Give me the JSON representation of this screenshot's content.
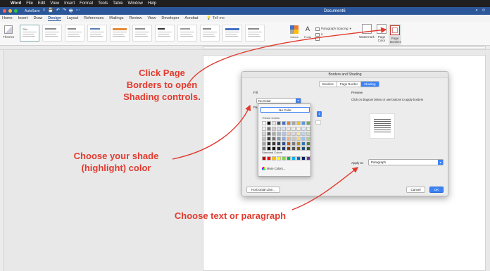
{
  "menubar": {
    "app": "Word",
    "items": [
      "File",
      "Edit",
      "View",
      "Insert",
      "Format",
      "Tools",
      "Table",
      "Window",
      "Help"
    ]
  },
  "titlebar": {
    "autosave": "AutoSave",
    "document_title": "Document6",
    "qat": [
      "⌂",
      "💾",
      "↶",
      "↷",
      "🖶",
      "⋯"
    ]
  },
  "tabs": [
    "Home",
    "Insert",
    "Draw",
    "Design",
    "Layout",
    "References",
    "Mailings",
    "Review",
    "View",
    "Developer",
    "Acrobat"
  ],
  "active_tab": "Design",
  "tell_me": "Tell me",
  "ribbon": {
    "themes_label": "Themes",
    "style_thumbs": [
      "Title",
      "",
      "",
      "",
      "",
      "",
      "",
      "",
      "",
      "",
      ""
    ],
    "colors_label": "Colors",
    "fonts_label": "Fonts",
    "paragraph_spacing_label": "Paragraph Spacing",
    "watermark_label": "Watermark",
    "page_color_label": "Page Color",
    "page_borders_label": "Page Borders"
  },
  "dialog": {
    "title": "Borders and Shading",
    "tabs": [
      "Borders",
      "Page Border",
      "Shading"
    ],
    "active_tab": "Shading",
    "fill_label": "Fill",
    "fill_value": "No Color",
    "pattern_label": "Pa",
    "preview_label": "Preview",
    "preview_hint": "Click on diagram below or use buttons to apply borders",
    "apply_to_label": "Apply to:",
    "apply_to_value": "Paragraph",
    "horizontal_line_label": "Horizontal Line...",
    "cancel_label": "Cancel",
    "ok_label": "OK"
  },
  "palette": {
    "no_color_label": "No Color",
    "theme_colors_label": "Theme Colors",
    "standard_colors_label": "Standard Colors",
    "more_colors_label": "More Colors...",
    "theme_top": [
      "#ffffff",
      "#000000",
      "#e7e6e6",
      "#44546a",
      "#4472c4",
      "#ed7d31",
      "#a5a5a5",
      "#ffc000",
      "#5b9bd5",
      "#70ad47"
    ],
    "theme_shades": [
      [
        "#f2f2f2",
        "#7f7f7f",
        "#d0cece",
        "#d6dce4",
        "#d9e2f3",
        "#fbe5d6",
        "#ededed",
        "#fff2cc",
        "#deebf6",
        "#e2efd9"
      ],
      [
        "#d9d9d9",
        "#595959",
        "#aeabab",
        "#adb9ca",
        "#b4c6e7",
        "#f7cbac",
        "#dbdbdb",
        "#fee599",
        "#bdd7ee",
        "#c5e0b3"
      ],
      [
        "#bfbfbf",
        "#3f3f3f",
        "#757070",
        "#8496b0",
        "#8eaadb",
        "#f4b183",
        "#c9c9c9",
        "#ffd965",
        "#9dc3e6",
        "#a8d08d"
      ],
      [
        "#a5a5a5",
        "#262626",
        "#3a3838",
        "#323f4f",
        "#2f5496",
        "#c55a11",
        "#7b7b7b",
        "#bf8f00",
        "#2e75b5",
        "#538135"
      ],
      [
        "#7f7f7f",
        "#0c0c0c",
        "#171616",
        "#222a35",
        "#1f3864",
        "#833c0b",
        "#525252",
        "#7f6000",
        "#1e4e79",
        "#375623"
      ]
    ],
    "standard": [
      "#c00000",
      "#ff0000",
      "#ffc000",
      "#ffff00",
      "#92d050",
      "#00b050",
      "#00b0f0",
      "#0070c0",
      "#002060",
      "#7030a0"
    ]
  },
  "annotations": {
    "page_borders": [
      "Click Page",
      "Borders to open",
      "Shading controls."
    ],
    "shade_color": [
      "Choose your shade",
      "(highlight) color"
    ],
    "text_or_paragraph": [
      "Choose text or paragraph"
    ]
  },
  "colors": {
    "accent": "#2b579a",
    "annotation": "#e23a2e",
    "dialog_accent": "#3b82f6"
  }
}
